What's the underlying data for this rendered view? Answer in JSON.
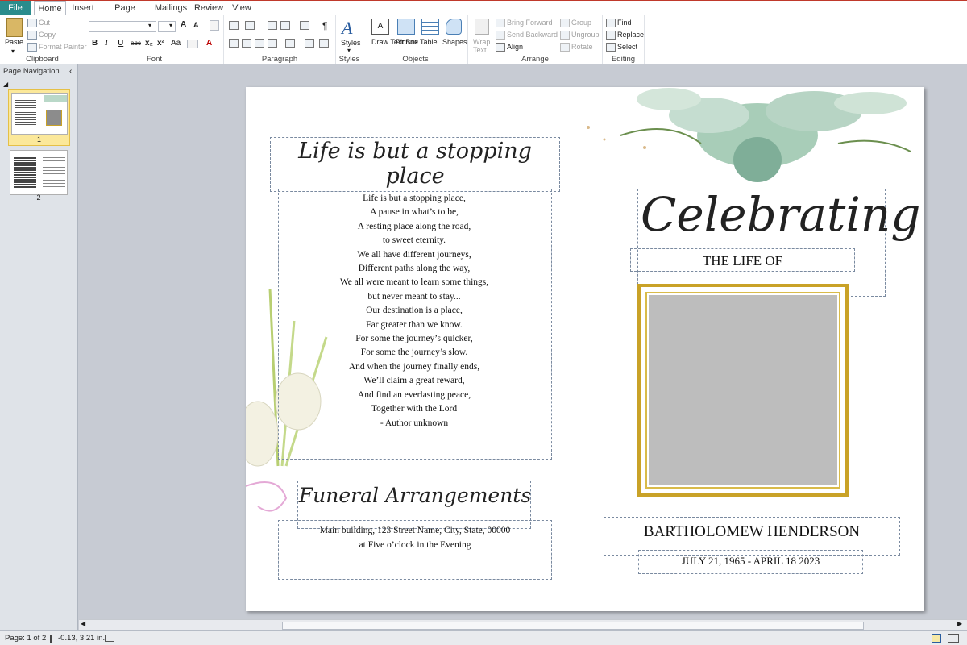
{
  "tabs": {
    "file": "File",
    "home": "Home",
    "insert": "Insert",
    "page_design": "Page Design",
    "mailings": "Mailings",
    "review": "Review",
    "view": "View"
  },
  "clipboard": {
    "paste": "Paste",
    "cut": "Cut",
    "copy": "Copy",
    "format_painter": "Format Painter",
    "label": "Clipboard"
  },
  "font": {
    "label": "Font",
    "bold": "B",
    "italic": "I",
    "underline": "U",
    "strike": "abc",
    "sub": "x₂",
    "sup": "x²",
    "case": "Aa",
    "grow": "A",
    "color": "A"
  },
  "paragraph": {
    "label": "Paragraph",
    "pilcrow": "¶"
  },
  "styles": {
    "label": "Styles",
    "button": "Styles"
  },
  "objects": {
    "label": "Objects",
    "draw_text_box": "Draw Text Box",
    "picture": "Picture",
    "table": "Table",
    "shapes": "Shapes"
  },
  "arrange": {
    "label": "Arrange",
    "wrap_text": "Wrap Text",
    "bring_forward": "Bring Forward",
    "send_backward": "Send Backward",
    "align": "Align",
    "group": "Group",
    "ungroup": "Ungroup",
    "rotate": "Rotate"
  },
  "editing": {
    "label": "Editing",
    "find": "Find",
    "replace": "Replace",
    "select": "Select"
  },
  "nav": {
    "title": "Page Navigation",
    "page1": "1",
    "page2": "2"
  },
  "doc": {
    "left_title": "Life is but a stopping place",
    "poem": [
      "Life is but a stopping place,",
      "A pause in what’s to be,",
      "A resting place along the road,",
      "to sweet eternity.",
      "We all have different journeys,",
      "Different paths along the way,",
      "We all were meant to learn some things,",
      "but never meant to stay...",
      "Our destination is a place,",
      "Far greater than we know.",
      "For some the journey’s quicker,",
      "For some the journey’s slow.",
      "And when the journey finally ends,",
      "We’ll claim a great reward,",
      "And find an everlasting peace,",
      "Together with the Lord",
      "- Author unknown"
    ],
    "funeral_title": "Funeral Arrangements",
    "address": "Main building, 123 Street Name, City, State, 00000",
    "time": "at Five o’clock in the Evening",
    "celebrating": "Celebrating",
    "life_of": "THE LIFE OF",
    "name": "BARTHOLOMEW HENDERSON",
    "dates": "JULY 21, 1965 - APRIL 18 2023"
  },
  "status": {
    "page": "Page: 1 of 2",
    "coords": "-0.13, 3.21 in."
  },
  "colors": {
    "file_tab": "#2a8c8c",
    "photo": "#bdbdbd",
    "gold": "#c9a227",
    "selected_thumb": "#fbe89a"
  }
}
